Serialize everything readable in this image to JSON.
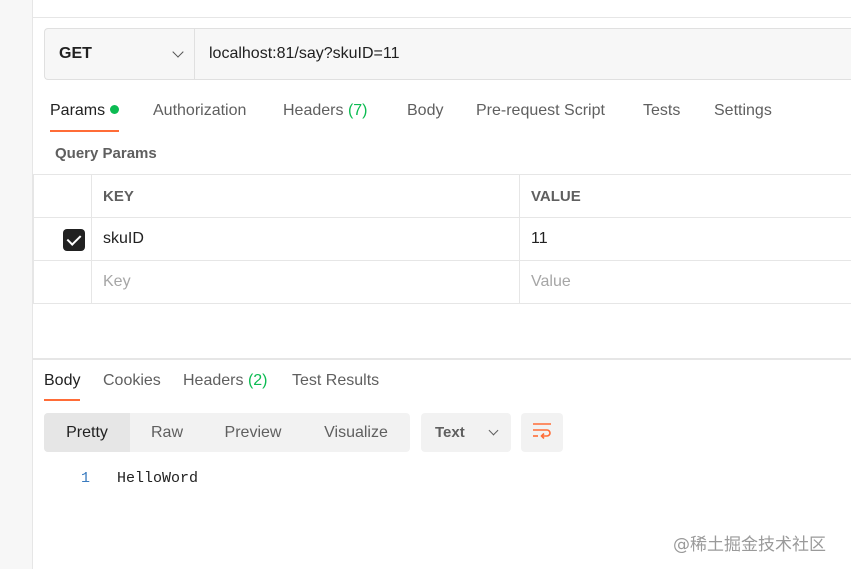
{
  "request": {
    "method": "GET",
    "url": "localhost:81/say?skuID=11"
  },
  "request_tabs": [
    {
      "label": "Params",
      "active": true,
      "dot": true
    },
    {
      "label": "Authorization"
    },
    {
      "label": "Headers",
      "count": "(7)"
    },
    {
      "label": "Body"
    },
    {
      "label": "Pre-request Script"
    },
    {
      "label": "Tests"
    },
    {
      "label": "Settings"
    }
  ],
  "query_params": {
    "title": "Query Params",
    "headers": {
      "key": "KEY",
      "value": "VALUE"
    },
    "rows": [
      {
        "checked": true,
        "key": "skuID",
        "value": "11"
      }
    ],
    "placeholder": {
      "key": "Key",
      "value": "Value"
    }
  },
  "response_tabs": [
    {
      "label": "Body",
      "active": true
    },
    {
      "label": "Cookies"
    },
    {
      "label": "Headers",
      "count": "(2)"
    },
    {
      "label": "Test Results"
    }
  ],
  "view_modes": [
    "Pretty",
    "Raw",
    "Preview",
    "Visualize"
  ],
  "active_view": "Pretty",
  "language": "Text",
  "body_lines": [
    {
      "num": "1",
      "text": "HelloWord"
    }
  ],
  "watermark": "@稀土掘金技术社区",
  "colors": {
    "accent": "#ff6c37",
    "count_green": "#0cbb52"
  }
}
